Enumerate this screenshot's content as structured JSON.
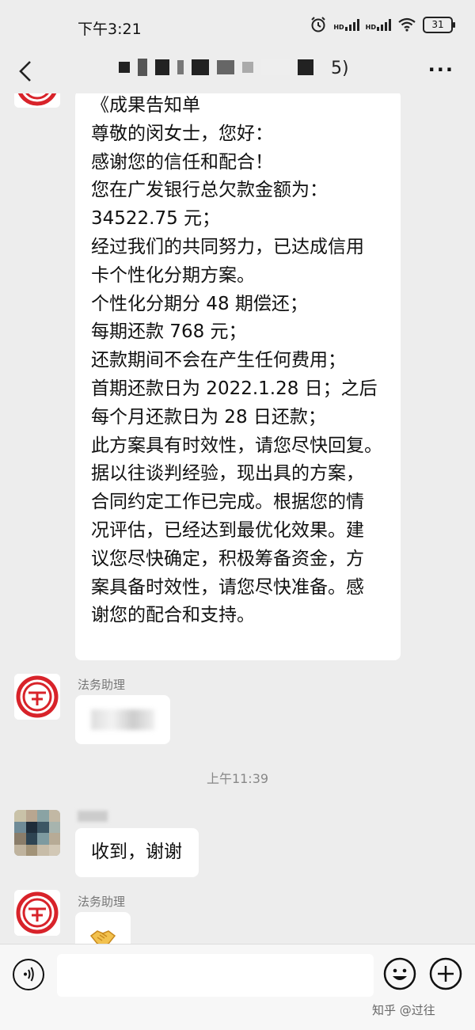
{
  "status_bar": {
    "time": "下午3:21",
    "hd_1": "HD",
    "hd_2": "HD",
    "battery": "31",
    "icons": [
      "alarm-icon",
      "signal-icon",
      "signal-icon",
      "wifi-icon",
      "battery-icon"
    ]
  },
  "nav": {
    "title_visible_suffix": "5)",
    "back_icon": "chevron-left-icon",
    "more_icon": "more-dots-icon"
  },
  "messages": {
    "notice": {
      "lines": [
        "《成果告知单",
        "尊敬的闵女士，您好：",
        "感谢您的信任和配合！",
        "您在广发银行总欠款金额为：",
        "34522.75 元；",
        "经过我们的共同努力，已达成信用",
        "卡个性化分期方案。",
        "个性化分期分 48 期偿还；",
        "每期还款 768 元；",
        "还款期间不会在产生任何费用；",
        "首期还款日为 2022.1.28 日；之后",
        "每个月还款日为 28 日还款；",
        "此方案具有时效性，请您尽快回复。",
        "据以往谈判经验，现出具的方案，",
        "合同约定工作已完成。根据您的情",
        "况评估，已经达到最优化效果。建",
        "议您尽快确定，积极筹备资金，方",
        "案具备时效性，请您尽快准备。感",
        "谢您的配合和支持。"
      ]
    },
    "legal_sender_1": "法务助理",
    "time_divider": "上午11:39",
    "user_reply": "收到，谢谢",
    "legal_sender_2": "法务助理",
    "handshake_icon": "handshake-emoji-icon"
  },
  "input_bar": {
    "voice_icon": "voice-icon",
    "emoji_icon": "emoji-icon",
    "plus_icon": "plus-icon",
    "placeholder": ""
  },
  "watermark": "知乎 @过往",
  "colors": {
    "background": "#ededed",
    "bubble": "#ffffff",
    "logo_red": "#d8232a"
  }
}
